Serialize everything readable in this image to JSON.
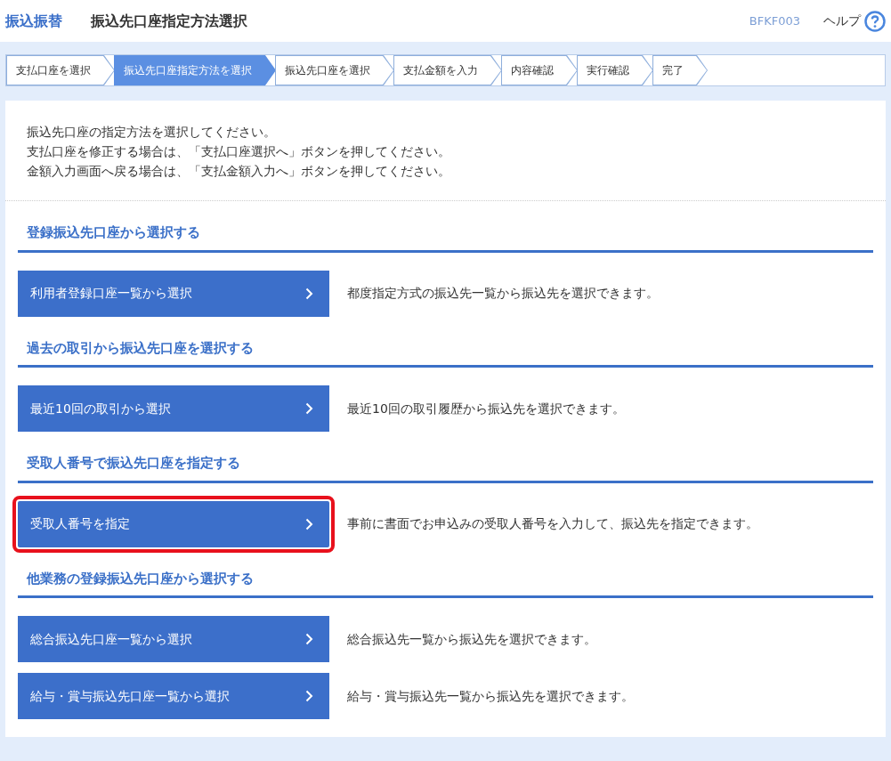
{
  "header": {
    "category": "振込振替",
    "title": "振込先口座指定方法選択",
    "screen_id": "BFKF003",
    "help": "ヘルプ"
  },
  "steps": [
    {
      "label": "支払口座を選択",
      "selected": false
    },
    {
      "label": "振込先口座指定方法を選択",
      "selected": true
    },
    {
      "label": "振込先口座を選択",
      "selected": false
    },
    {
      "label": "支払金額を入力",
      "selected": false
    },
    {
      "label": "内容確認",
      "selected": false
    },
    {
      "label": "実行確認",
      "selected": false
    },
    {
      "label": "完了",
      "selected": false
    }
  ],
  "instructions": [
    "振込先口座の指定方法を選択してください。",
    "支払口座を修正する場合は、「支払口座選択へ」ボタンを押してください。",
    "金額入力画面へ戻る場合は、「支払金額入力へ」ボタンを押してください。"
  ],
  "sections": [
    {
      "heading": "登録振込先口座から選択する",
      "options": [
        {
          "button": "利用者登録口座一覧から選択",
          "description": "都度指定方式の振込先一覧から振込先を選択できます。",
          "highlighted": false
        }
      ]
    },
    {
      "heading": "過去の取引から振込先口座を選択する",
      "options": [
        {
          "button": "最近10回の取引から選択",
          "description": "最近10回の取引履歴から振込先を選択できます。",
          "highlighted": false
        }
      ]
    },
    {
      "heading": "受取人番号で振込先口座を指定する",
      "options": [
        {
          "button": "受取人番号を指定",
          "description": "事前に書面でお申込みの受取人番号を入力して、振込先を指定できます。",
          "highlighted": true
        }
      ]
    },
    {
      "heading": "他業務の登録振込先口座から選択する",
      "options": [
        {
          "button": "総合振込先口座一覧から選択",
          "description": "総合振込先一覧から振込先を選択できます。",
          "highlighted": false
        },
        {
          "button": "給与・賞与振込先口座一覧から選択",
          "description": "給与・賞与振込先一覧から振込先を選択できます。",
          "highlighted": false
        }
      ]
    }
  ]
}
